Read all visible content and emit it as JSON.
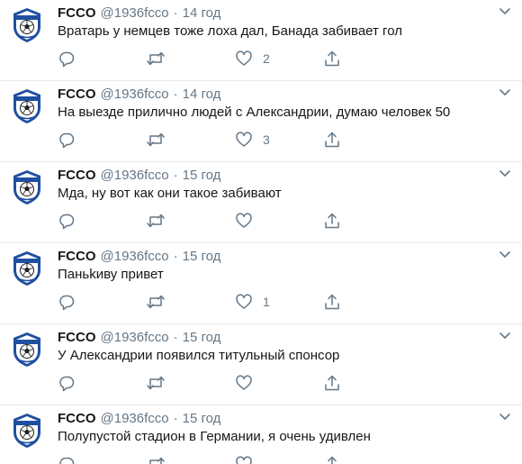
{
  "tweets": [
    {
      "name": "FCCO",
      "handle": "@1936fcco",
      "sep": "·",
      "time": "14 год",
      "text": "Вратарь у немцев тоже лоха дал, Банада забивает гол",
      "replies": "",
      "retweets": "",
      "likes": "2"
    },
    {
      "name": "FCCO",
      "handle": "@1936fcco",
      "sep": "·",
      "time": "14 год",
      "text": "На выезде прилично людей с Александрии, думаю человек 50",
      "replies": "",
      "retweets": "",
      "likes": "3"
    },
    {
      "name": "FCCO",
      "handle": "@1936fcco",
      "sep": "·",
      "time": "15 год",
      "text": "Мда, ну вот как они такое забивают",
      "replies": "",
      "retweets": "",
      "likes": ""
    },
    {
      "name": "FCCO",
      "handle": "@1936fcco",
      "sep": "·",
      "time": "15 год",
      "text": "Паньkиву привет",
      "replies": "",
      "retweets": "",
      "likes": "1"
    },
    {
      "name": "FCCO",
      "handle": "@1936fcco",
      "sep": "·",
      "time": "15 год",
      "text": "У Александрии появился титульный спонсор",
      "replies": "",
      "retweets": "",
      "likes": ""
    },
    {
      "name": "FCCO",
      "handle": "@1936fcco",
      "sep": "·",
      "time": "15 год",
      "text": "Полупустой стадион в Германии, я очень удивлен",
      "replies": "",
      "retweets": "",
      "likes": ""
    }
  ],
  "icons": {
    "reply": "reply-icon",
    "retweet": "retweet-icon",
    "like": "heart-icon",
    "share": "share-icon",
    "caret": "chevron-down-icon",
    "avatar": "club-crest-avatar"
  },
  "colors": {
    "text": "#14171a",
    "secondary": "#657786",
    "divider": "#e6ecf0",
    "crest_blue": "#1f4fa0"
  }
}
